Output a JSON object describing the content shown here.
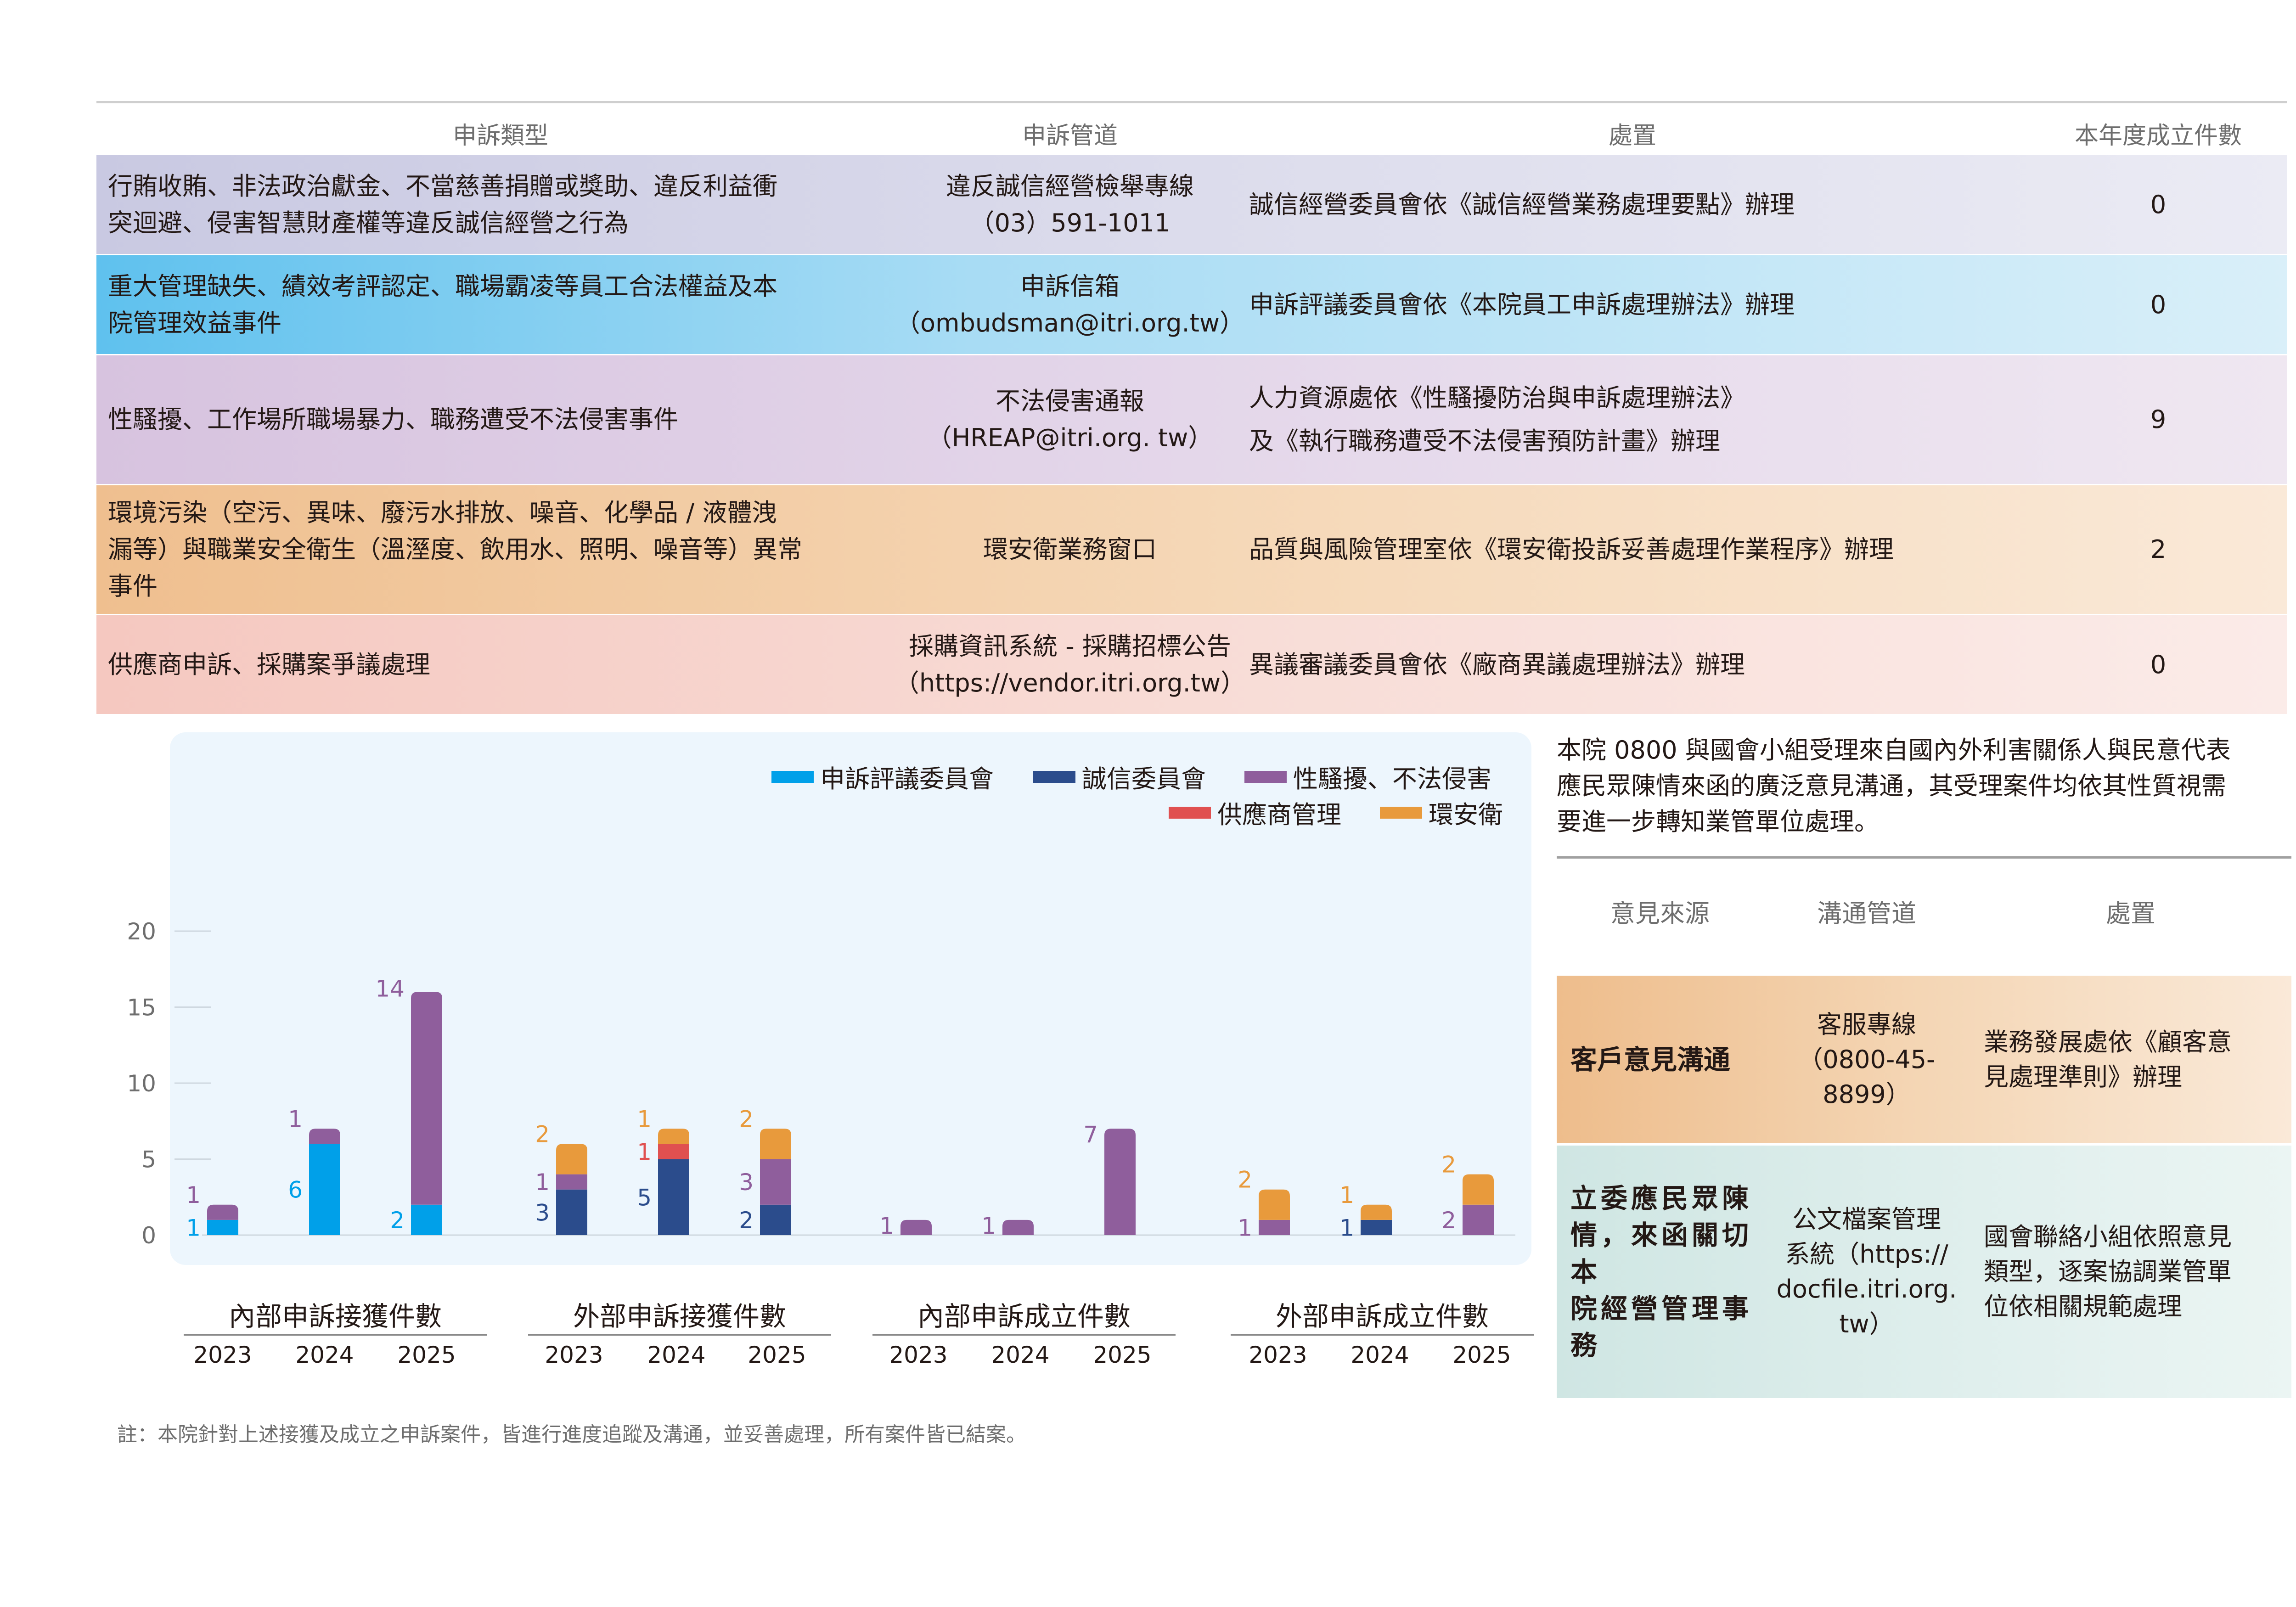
{
  "table": {
    "headers": [
      "申訴類型",
      "申訴管道",
      "處置",
      "本年度成立件數"
    ],
    "rows": [
      {
        "type_lines": [
          "行賄收賄、非法政治獻金、不當慈善捐贈或獎助、違反利益衝",
          "突迴避、侵害智慧財產權等違反誠信經營之行為"
        ],
        "channel_lines": [
          "違反誠信經營檢舉專線",
          "（03）591-1011"
        ],
        "action_lines": [
          "誠信經營委員會依《誠信經營業務處理要點》辦理"
        ],
        "count": "0"
      },
      {
        "type_lines": [
          "重大管理缺失、績效考評認定、職場霸凌等員工合法權益及本",
          "院管理效益事件"
        ],
        "channel_lines": [
          "申訴信箱",
          "（ombudsman@itri.org.tw）"
        ],
        "action_lines": [
          "申訴評議委員會依《本院員工申訴處理辦法》辦理"
        ],
        "count": "0"
      },
      {
        "type_lines": [
          "性騷擾、工作場所職場暴力、職務遭受不法侵害事件"
        ],
        "channel_lines": [
          "不法侵害通報",
          "（HREAP@itri.org. tw）"
        ],
        "action_lines": [
          "人力資源處依《性騷擾防治與申訴處理辦法》",
          "及《執行職務遭受不法侵害預防計畫》辦理"
        ],
        "count": "9"
      },
      {
        "type_lines": [
          "環境污染（空污、異味、廢污水排放、噪音、化學品 / 液體洩",
          "漏等）與職業安全衛生（溫溼度、飲用水、照明、噪音等）異常",
          "事件"
        ],
        "channel_lines": [
          "環安衛業務窗口"
        ],
        "action_lines": [
          "品質與風險管理室依《環安衛投訴妥善處理作業程序》辦理"
        ],
        "count": "2"
      },
      {
        "type_lines": [
          "供應商申訴、採購案爭議處理"
        ],
        "channel_lines": [
          "採購資訊系統 - 採購招標公告",
          "（https://vendor.itri.org.tw）"
        ],
        "action_lines": [
          "異議審議委員會依《廠商異議處理辦法》辦理"
        ],
        "count": "0"
      }
    ]
  },
  "chart_data": {
    "type": "bar",
    "stacked": true,
    "ylim": [
      0,
      20
    ],
    "yticks": [
      0,
      5,
      10,
      15,
      20
    ],
    "grid": false,
    "legend_position": "top-right",
    "legend": [
      {
        "name": "申訴評議委員會",
        "color": "#00a0e9"
      },
      {
        "name": "誠信委員會",
        "color": "#2b4c8c"
      },
      {
        "name": "性騷擾、不法侵害",
        "color": "#8f5e9c"
      },
      {
        "name": "供應商管理",
        "color": "#e05050"
      },
      {
        "name": "環安衛",
        "color": "#e89a3c"
      }
    ],
    "groups": [
      {
        "title": "內部申訴接獲件數",
        "years": [
          "2023",
          "2024",
          "2025"
        ],
        "values": [
          {
            "申訴評議委員會": 1,
            "性騷擾、不法侵害": 1
          },
          {
            "申訴評議委員會": 6,
            "性騷擾、不法侵害": 1
          },
          {
            "申訴評議委員會": 2,
            "性騷擾、不法侵害": 14
          }
        ]
      },
      {
        "title": "外部申訴接獲件數",
        "years": [
          "2023",
          "2024",
          "2025"
        ],
        "values": [
          {
            "誠信委員會": 3,
            "性騷擾、不法侵害": 1,
            "環安衛": 2
          },
          {
            "誠信委員會": 5,
            "供應商管理": 1,
            "環安衛": 1
          },
          {
            "誠信委員會": 2,
            "性騷擾、不法侵害": 3,
            "環安衛": 2
          }
        ]
      },
      {
        "title": "內部申訴成立件數",
        "years": [
          "2023",
          "2024",
          "2025"
        ],
        "values": [
          {
            "性騷擾、不法侵害": 1
          },
          {
            "性騷擾、不法侵害": 1
          },
          {
            "性騷擾、不法侵害": 7
          }
        ]
      },
      {
        "title": "外部申訴成立件數",
        "years": [
          "2023",
          "2024",
          "2025"
        ],
        "values": [
          {
            "性騷擾、不法侵害": 1,
            "環安衛": 2
          },
          {
            "誠信委員會": 1,
            "環安衛": 1
          },
          {
            "性騷擾、不法侵害": 2,
            "環安衛": 2
          }
        ]
      }
    ]
  },
  "footnote": "註：本院針對上述接獲及成立之申訴案件，皆進行進度追蹤及溝通，並妥善處理，所有案件皆已結案。",
  "side": {
    "intro_lines": [
      "本院 0800 與國會小組受理來自國內外利害關係人與民意代表",
      "應民眾陳情來函的廣泛意見溝通，其受理案件均依其性質視需",
      "要進一步轉知業管單位處理。"
    ],
    "headers": [
      "意見來源",
      "溝通管道",
      "處置"
    ],
    "rows": [
      {
        "source_lines": [
          "客戶意見溝通"
        ],
        "channel_lines": [
          "客服專線",
          "（0800-45-8899）"
        ],
        "action_lines": [
          "業務發展處依《顧客意",
          "見處理準則》辦理"
        ]
      },
      {
        "source_lines": [
          "立委應民眾陳",
          "情，來函關切本",
          "院經營管理事",
          "務"
        ],
        "channel_lines": [
          "公文檔案管理",
          "系統（https://",
          "docfile.itri.org.",
          "tw）"
        ],
        "action_lines": [
          "國會聯絡小組依照意見",
          "類型，逐案協調業管單",
          "位依相關規範處理"
        ]
      }
    ]
  }
}
